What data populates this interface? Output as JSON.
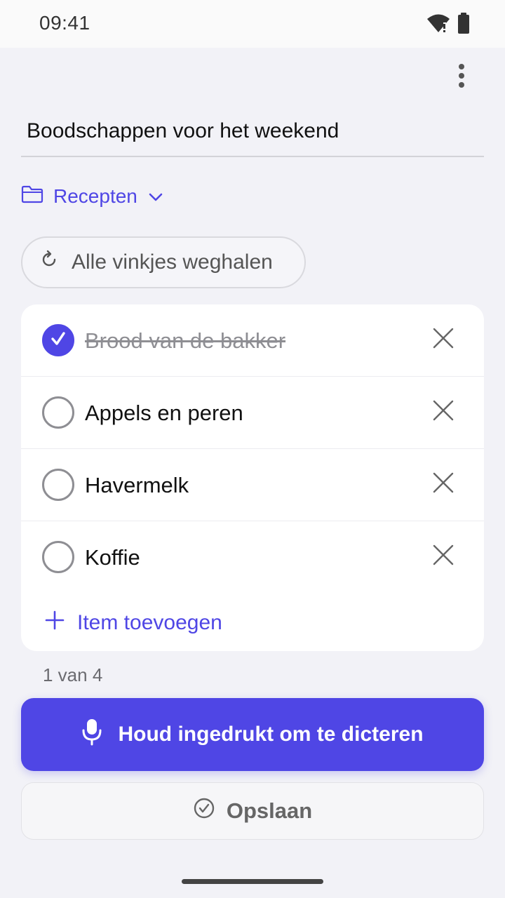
{
  "status_bar": {
    "time": "09:41",
    "icons": [
      "wifi-alert-icon",
      "battery-icon"
    ]
  },
  "header": {
    "more_icon": "more-vertical-icon"
  },
  "note": {
    "title": "Boodschappen voor het weekend",
    "folder": "Recepten"
  },
  "actions": {
    "reset_label": "Alle vinkjes weghalen"
  },
  "list": {
    "items": [
      {
        "label": "Brood van de bakker",
        "checked": true
      },
      {
        "label": "Appels en peren",
        "checked": false
      },
      {
        "label": "Havermelk",
        "checked": false
      },
      {
        "label": "Koffie",
        "checked": false
      }
    ],
    "add_label": "Item toevoegen",
    "counter": "1 van 4"
  },
  "footer": {
    "dictate_label": "Houd ingedrukt om te dicteren",
    "save_label": "Opslaan"
  },
  "colors": {
    "accent": "#4f46e5",
    "background": "#f2f2f7",
    "card": "#ffffff"
  }
}
